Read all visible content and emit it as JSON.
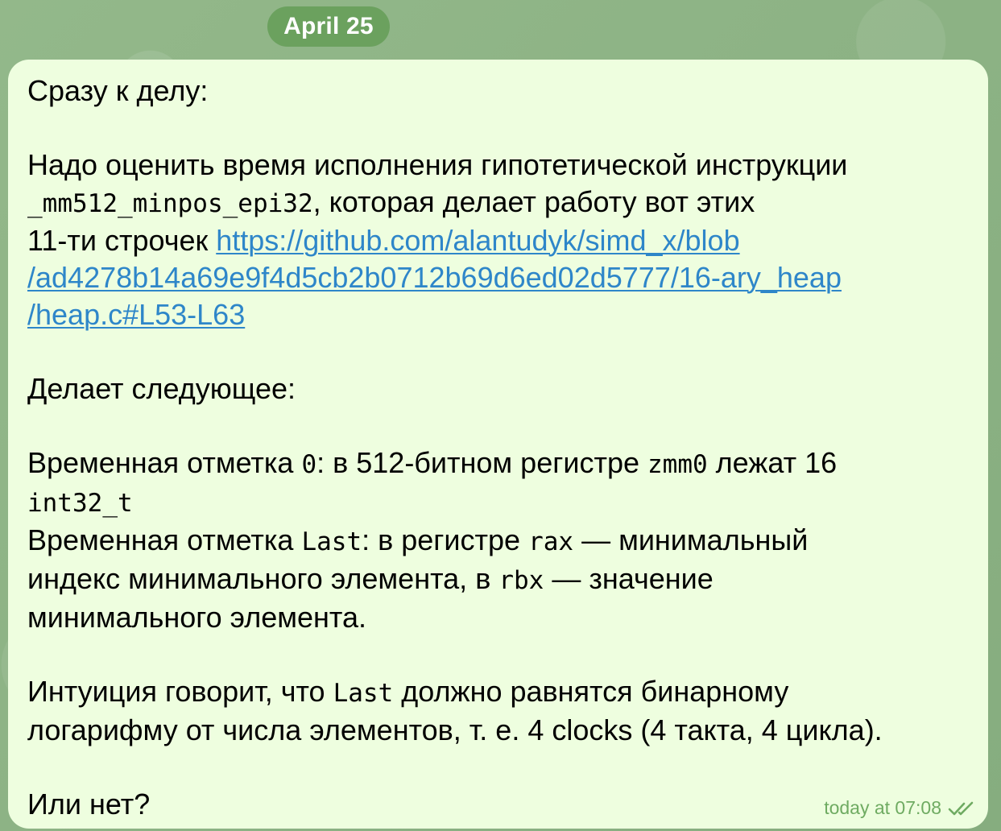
{
  "date_separator": "April 25",
  "message": {
    "intro": "Сразу к делу:",
    "p1": {
      "text_a": "Надо оценить время исполнения гипотетической инструкции",
      "code": "_mm512_minpos_epi32",
      "text_b": ", которая делает работу вот этих",
      "text_c": "11-ти строчек ",
      "link_line1": "https://github.com/alantudyk/simd_x/blob",
      "link_line2": "/ad4278b14a69e9f4d5cb2b0712b69d6ed02d5777/16-ary_heap",
      "link_line3": "/heap.c#L53-L63"
    },
    "p2": "Делает следующее:",
    "p3": {
      "a1": "Временная отметка ",
      "c1": "0",
      "a2": ": в 512-битном регистре ",
      "c2": "zmm0",
      "a3": " лежат 16",
      "c3": "int32_t",
      "b1": "Временная отметка ",
      "c4": "Last",
      "b2": ": в регистре ",
      "c5": "rax",
      "b3": " — минимальный",
      "b4": "индекс минимального элемента, в ",
      "c6": "rbx",
      "b5": " — значение",
      "b6": "минимального элемента."
    },
    "p4": {
      "a1": "Интуиция говорит, что ",
      "c1": "Last",
      "a2": " должно равнятся бинарному",
      "a3": "логарифму от числа элементов, т. е. 4  clocks (4 такта, 4 цикла)."
    },
    "p5": "Или нет?",
    "timestamp": "today at 07:08",
    "status_icon": "double-check-icon"
  },
  "colors": {
    "bubble": "#eefedf",
    "date_pill": "#6ba15e",
    "link": "#2e86c9",
    "meta": "#6fab62",
    "background": "#8fb386"
  }
}
